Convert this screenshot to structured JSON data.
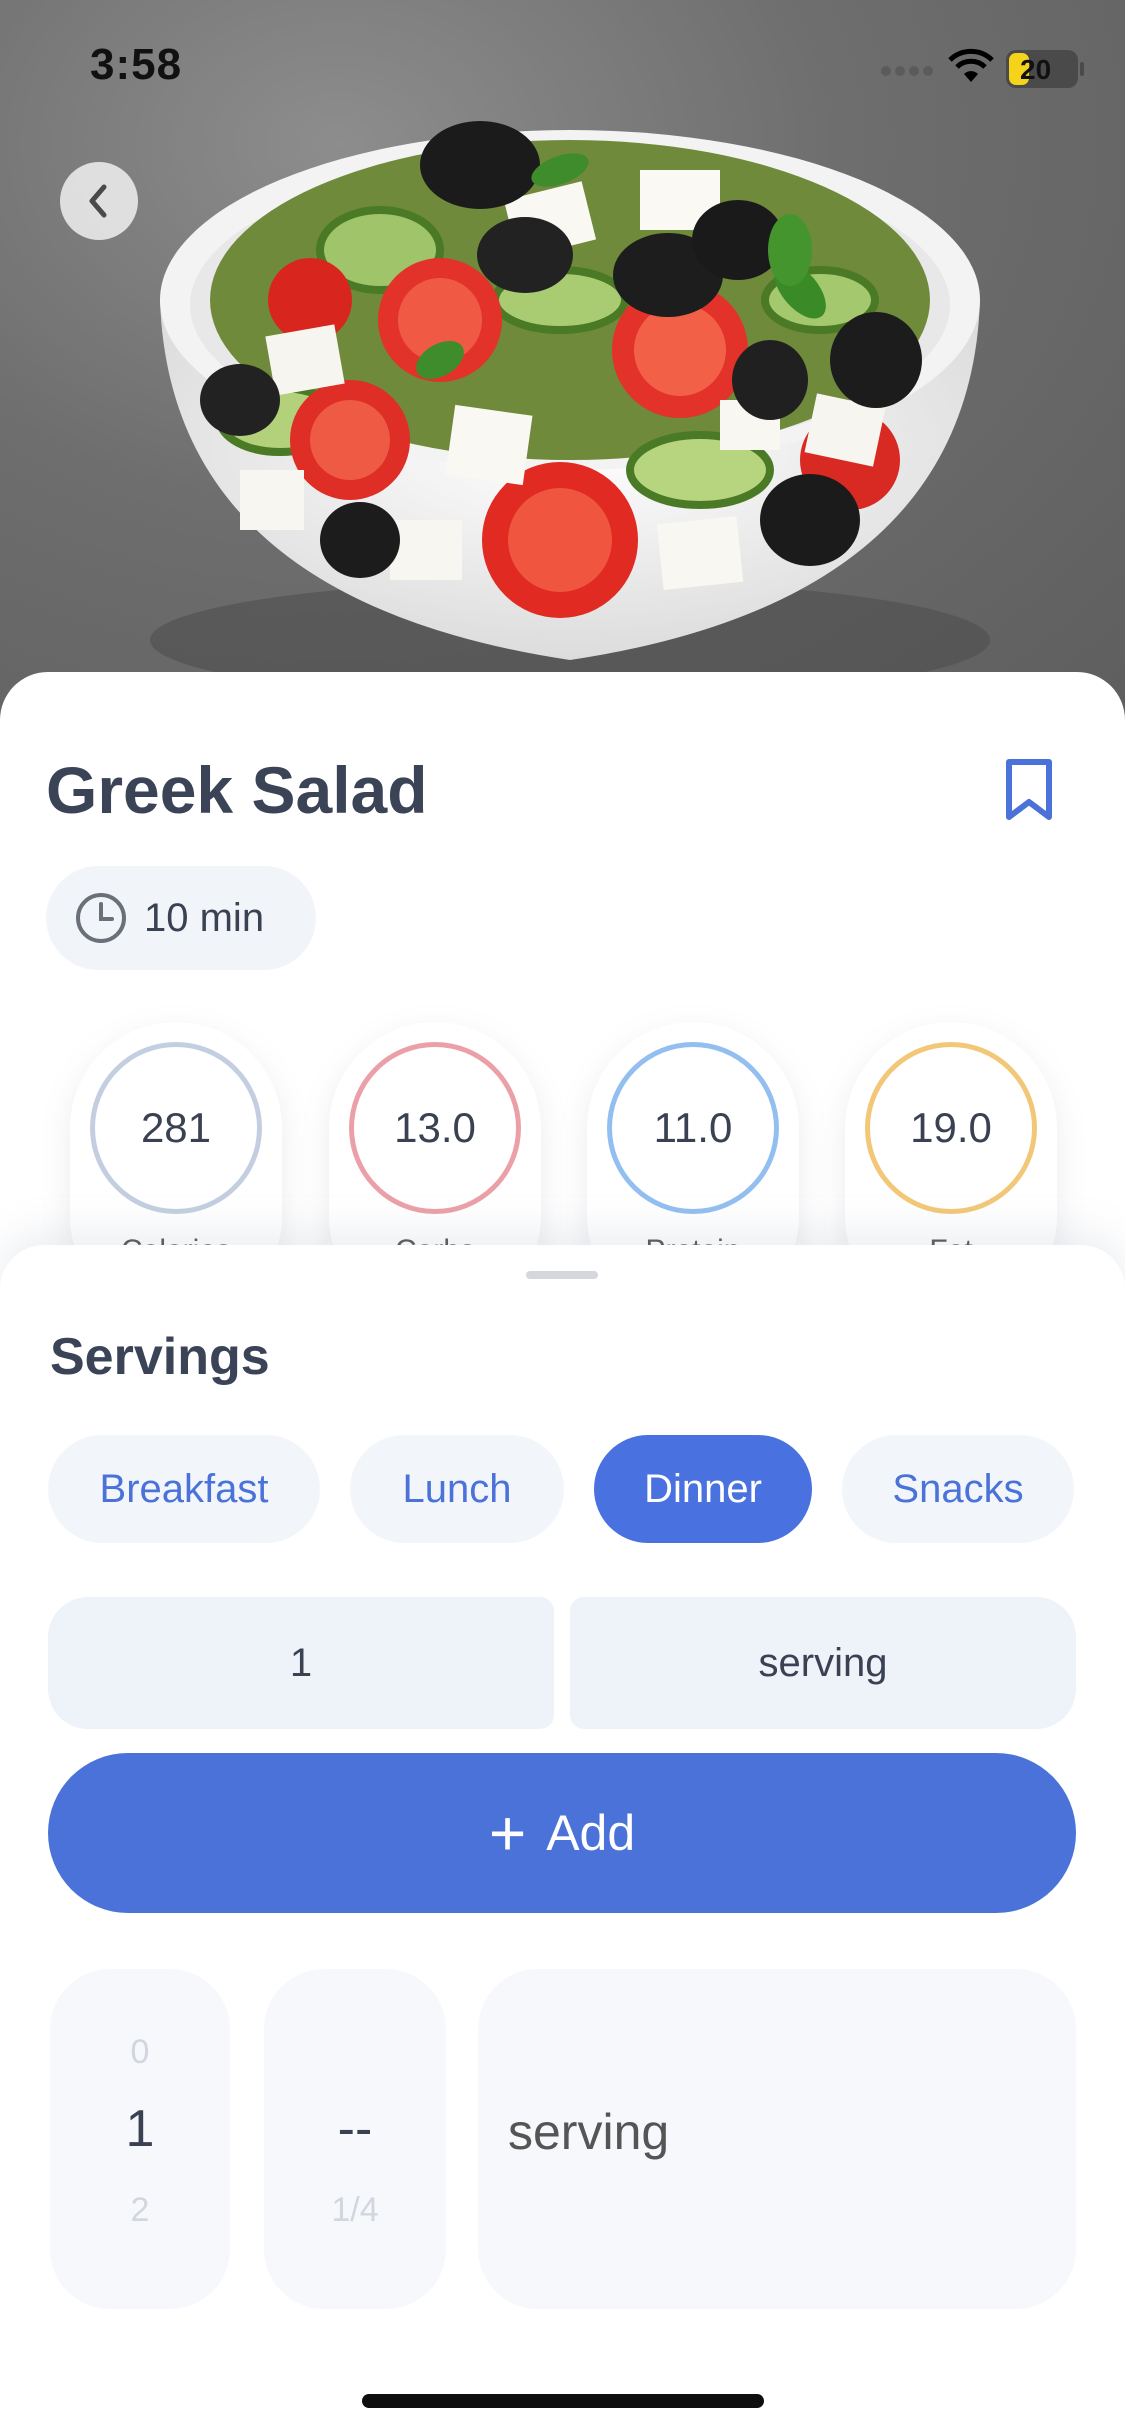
{
  "status_bar": {
    "time": "3:58",
    "battery_level": "20"
  },
  "hero": {
    "image_description_icon": "greek-salad-bowl-photo"
  },
  "recipe": {
    "title": "Greek Salad",
    "prep_time": "10 min",
    "nutrition": [
      {
        "value": "281",
        "label": "Calories",
        "color": "#c3cfe0"
      },
      {
        "value": "13.0",
        "label": "Carbs",
        "color": "#eba0a8"
      },
      {
        "value": "11.0",
        "label": "Protein",
        "color": "#92bff0"
      },
      {
        "value": "19.0",
        "label": "Fat",
        "color": "#f2c878"
      }
    ]
  },
  "sheet": {
    "title": "Servings",
    "meals": [
      {
        "label": "Breakfast",
        "active": false
      },
      {
        "label": "Lunch",
        "active": false
      },
      {
        "label": "Dinner",
        "active": true
      },
      {
        "label": "Snacks",
        "active": false
      }
    ],
    "quantity": "1",
    "unit": "serving",
    "add_label": "Add",
    "picker": {
      "whole": {
        "above": "0",
        "selected": "1",
        "below": "2"
      },
      "fraction": {
        "selected": "--",
        "below": "1/4"
      },
      "unit": "serving"
    }
  },
  "colors": {
    "accent": "#4a72d8",
    "active_chip": "#4971df",
    "chip_bg": "#f2f6fb"
  }
}
